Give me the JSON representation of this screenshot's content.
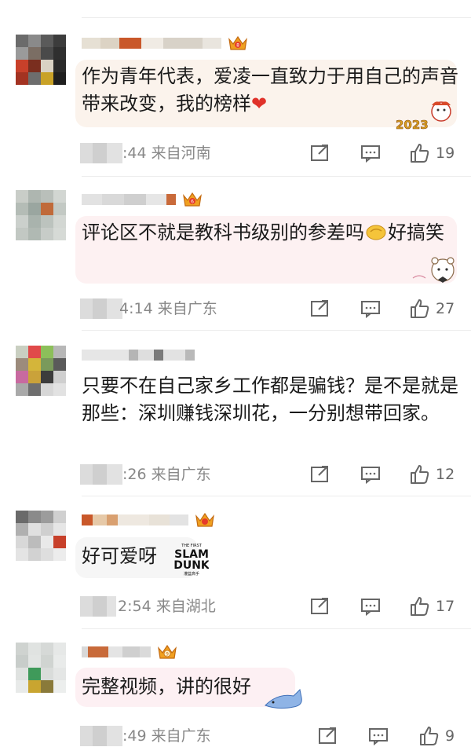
{
  "comments": [
    {
      "avatar_colors": [
        "#6b6b6b",
        "#8a8a8a",
        "#5a5a5a",
        "#3c3c3c",
        "#9a9a9a",
        "#7b6e64",
        "#4a4a4a",
        "#2f2f2f",
        "#c8402a",
        "#7a2e1f",
        "#d9d2c4",
        "#2a2a2a",
        "#a33322",
        "#6d6d6d",
        "#c9a227",
        "#1f1f1f"
      ],
      "name_colors": [
        "#e6e0d4",
        "#dcd3c4",
        "#c9582a",
        "#f0ebe4",
        "#d8d2c8",
        "#e9e5de"
      ],
      "text_parts": [
        "作为青年代表，爱凌一直致力于用自己的声音带来改变，我的榜样"
      ],
      "heart": "❤",
      "time": ":44",
      "location": "来自河南",
      "likes": "19",
      "bubble_color": "#fbf3ec",
      "deco_text": "2023"
    },
    {
      "avatar_colors": [
        "#c9cdc8",
        "#aeb6b0",
        "#b9bfba",
        "#d2d6d2",
        "#b4bcb6",
        "#9aa6a0",
        "#c06a3a",
        "#c3c9c4",
        "#cbd0cc",
        "#a9b3ad",
        "#bcc3be",
        "#d3d7d3",
        "#c2c8c3",
        "#b0b9b3",
        "#c7ccc8",
        "#d6dad6"
      ],
      "name_colors": [
        "#e2e2e2",
        "#d9d9d9",
        "#cfcfcf",
        "#e6e6e6",
        "#c96a3a"
      ],
      "text_parts": [
        "评论区不就是教科书级别的参差吗",
        "好搞笑"
      ],
      "time": "4:14",
      "location": "来自广东",
      "likes": "27",
      "bubble_color": "#fdf1f2"
    },
    {
      "avatar_colors": [
        "#c9cfc1",
        "#e04a4a",
        "#8cbf5a",
        "#b7b7b7",
        "#9c8b7c",
        "#d4b53a",
        "#7a9a5b",
        "#5a5a5a",
        "#c86aa0",
        "#caa23a",
        "#3c3c3c",
        "#cfcfcf",
        "#a9a9a9",
        "#6e6e6e",
        "#d7d7d7",
        "#e2e2e2"
      ],
      "name_colors": [
        "#e6e6e6",
        "#b5b5b5",
        "#dedede",
        "#7a7a7a",
        "#e2e2e2",
        "#b9b9b9"
      ],
      "text_parts": [
        "只要不在自己家乡工作都是骗钱？是不是就是那些：深圳赚钱深圳花，一分别想带回家。"
      ],
      "time": ":26",
      "location": "来自广东",
      "likes": "12"
    },
    {
      "avatar_colors": [
        "#6a6a6a",
        "#8a8a8a",
        "#9c9c9c",
        "#d0d0d0",
        "#b0b0b0",
        "#e0e0e0",
        "#cfcfcf",
        "#e6e6e6",
        "#d8d8d8",
        "#bcbcbc",
        "#e9e9e9",
        "#c7402a",
        "#e4e4e4",
        "#d2d2d2",
        "#dedede",
        "#ececec"
      ],
      "name_colors": [
        "#c9582a",
        "#e6c9a8",
        "#d9a070",
        "#eee8e0",
        "#e8e2d8",
        "#e3e3e3"
      ],
      "text_parts": [
        "好可爱呀"
      ],
      "time": "2:54",
      "location": "来自湖北",
      "likes": "17",
      "bubble_color": "#f6f6f6",
      "deco_lines": [
        "THE FIRST",
        "SLAM",
        "DUNK",
        "灌篮高手"
      ]
    },
    {
      "avatar_colors": [
        "#cfd3d0",
        "#e0e3e1",
        "#d6d9d7",
        "#e6e8e7",
        "#c8cdca",
        "#e2e5e3",
        "#d0d4d1",
        "#e9ebea",
        "#dfe2e0",
        "#3f9a5a",
        "#d9dcda",
        "#e4e6e5",
        "#e8eae9",
        "#c9a530",
        "#8a7a3a",
        "#eceeed"
      ],
      "name_colors": [
        "#d8d8d8",
        "#c86a3a",
        "#e4e4e4",
        "#cfcfcf",
        "#dadada"
      ],
      "text_parts": [
        "完整视频，讲的很好"
      ],
      "time": ":49",
      "location": "来自广东",
      "likes": "9",
      "bubble_color": "#fdf0f3"
    }
  ]
}
